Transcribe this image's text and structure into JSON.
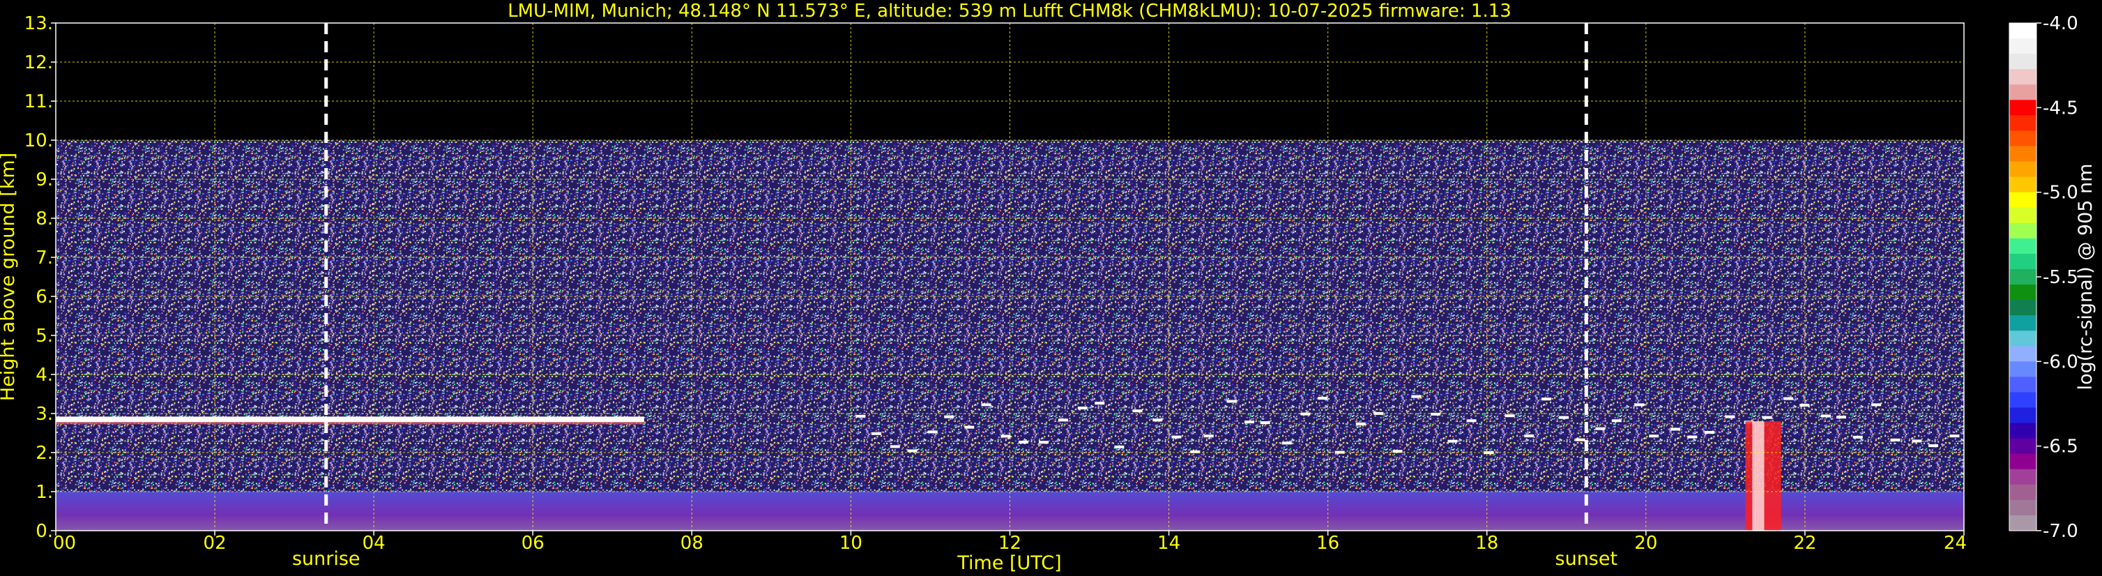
{
  "chart_data": {
    "type": "heatmap",
    "title": "LMU-MIM, Munich; 48.148° N 11.573° E, altitude: 539 m    Lufft CHM8k (CHM8kLMU): 10-07-2025    firmware: 1.13",
    "xlabel": "Time [UTC]",
    "ylabel": "Height above ground [km]",
    "xlim": [
      0,
      24
    ],
    "ylim": [
      0,
      13
    ],
    "x_ticks": [
      "00",
      "02",
      "04",
      "06",
      "08",
      "10",
      "12",
      "14",
      "16",
      "18",
      "20",
      "22",
      "24"
    ],
    "y_ticks": [
      "0.",
      "1.",
      "2.",
      "3.",
      "4.",
      "5.",
      "6.",
      "7.",
      "8.",
      "9.",
      "10.",
      "11.",
      "12.",
      "13."
    ],
    "grid": true,
    "markers": [
      {
        "label": "sunrise",
        "x": 3.4
      },
      {
        "label": "sunset",
        "x": 19.25
      }
    ],
    "colorbar": {
      "label": "log(rc-signal) @ 905 nm",
      "range": [
        -7.0,
        -4.0
      ],
      "ticks": [
        "-4.0",
        "-4.5",
        "-5.0",
        "-5.5",
        "-6.0",
        "-6.5",
        "-7.0"
      ],
      "colors": [
        "#ffffff",
        "#f4f4f4",
        "#e8e8e8",
        "#f0c8c8",
        "#e8a0a0",
        "#ff0000",
        "#ff2a00",
        "#ff5500",
        "#ff8000",
        "#ffa500",
        "#ffc800",
        "#ffff00",
        "#d8ff28",
        "#a0ff50",
        "#40f090",
        "#20d080",
        "#20b060",
        "#109010",
        "#108050",
        "#10a0a0",
        "#60c8d8",
        "#90b0ff",
        "#6888ff",
        "#5060ff",
        "#3040ff",
        "#2020e0",
        "#3000b0",
        "#6000a0",
        "#900090",
        "#a04098",
        "#a06090",
        "#a07898",
        "#a898a8"
      ]
    },
    "features": [
      {
        "name": "cloud layer",
        "x_range": [
          0,
          7.4
        ],
        "height_km": 2.85
      },
      {
        "name": "broken cloud layer",
        "x_range": [
          10,
          24
        ],
        "height_km": [
          2.0,
          3.5
        ]
      },
      {
        "name": "boundary layer (high backscatter)",
        "x_range": [
          0,
          24
        ],
        "height_km": [
          0,
          1.0
        ]
      },
      {
        "name": "precipitation",
        "x_range": [
          21.25,
          21.7
        ],
        "height_km": [
          0,
          2.8
        ]
      }
    ]
  }
}
